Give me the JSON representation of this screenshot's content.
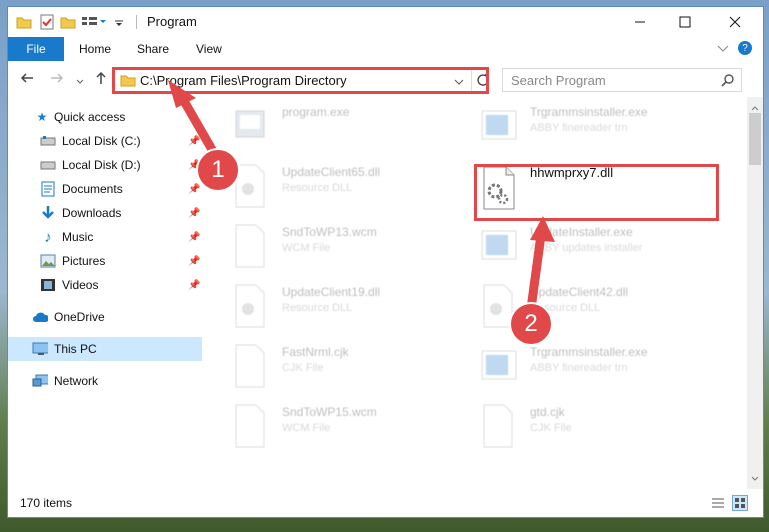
{
  "window": {
    "title": "Program"
  },
  "ribbon": {
    "file": "File",
    "home": "Home",
    "share": "Share",
    "view": "View"
  },
  "address": {
    "path": "C:\\Program Files\\Program Directory"
  },
  "search": {
    "placeholder": "Search Program"
  },
  "sidebar": {
    "quick_access": "Quick access",
    "items": [
      {
        "label": "Local Disk (C:)",
        "icon": "local-disk-icon"
      },
      {
        "label": "Local Disk (D:)",
        "icon": "local-disk-icon"
      },
      {
        "label": "Documents",
        "icon": "documents-icon"
      },
      {
        "label": "Downloads",
        "icon": "downloads-icon"
      },
      {
        "label": "Music",
        "icon": "music-icon"
      },
      {
        "label": "Pictures",
        "icon": "pictures-icon"
      },
      {
        "label": "Videos",
        "icon": "videos-icon"
      }
    ],
    "onedrive": "OneDrive",
    "this_pc": "This PC",
    "network": "Network"
  },
  "files": {
    "f1": {
      "name": "program.exe",
      "sub": ""
    },
    "f2": {
      "name": "Trgrammsinstaller.exe",
      "sub": "ABBY finereader trn"
    },
    "f3": {
      "name": "UpdateClient65.dll",
      "sub": "Resource DLL"
    },
    "f4": {
      "name": "hhwmprxy7.dll",
      "sub": ""
    },
    "f5": {
      "name": "SndToWP13.wcm",
      "sub": "WCM File"
    },
    "f6": {
      "name": "UpdateInstaller.exe",
      "sub": "ABBY updates installer"
    },
    "f7": {
      "name": "UpdateClient19.dll",
      "sub": "Resource DLL"
    },
    "f8": {
      "name": "UpdateClient42.dll",
      "sub": "Resource DLL"
    },
    "f9": {
      "name": "FastNrml.cjk",
      "sub": "CJK File"
    },
    "f10": {
      "name": "Trgrammsinstaller.exe",
      "sub": "ABBY finereader trn"
    },
    "f11": {
      "name": "SndToWP15.wcm",
      "sub": "WCM File"
    },
    "f12": {
      "name": "gtd.cjk",
      "sub": "CJK File"
    }
  },
  "status": {
    "count": "170 items"
  },
  "callouts": {
    "one": "1",
    "two": "2"
  },
  "colors": {
    "accent": "#1979ca",
    "highlight": "#e0484a",
    "selected": "#cce8ff"
  }
}
